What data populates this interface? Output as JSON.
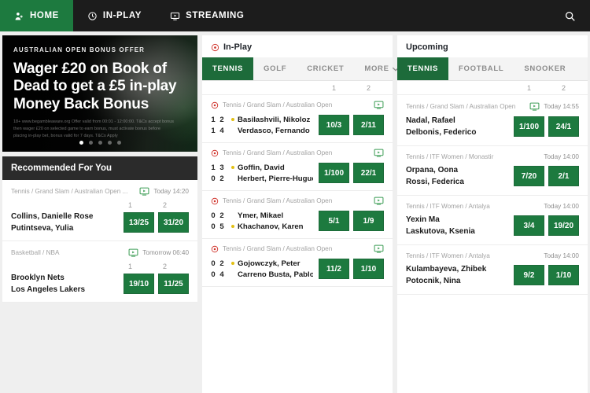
{
  "nav": {
    "items": [
      {
        "label": "HOME",
        "icon": "home-icon",
        "active": true
      },
      {
        "label": "IN-PLAY",
        "icon": "clock-icon",
        "active": false
      },
      {
        "label": "STREAMING",
        "icon": "monitor-icon",
        "active": false
      }
    ],
    "search_icon": "search-icon"
  },
  "banner": {
    "kicker": "AUSTRALIAN OPEN BONUS OFFER",
    "title": "Wager £20 on Book of Dead to get a £5 in-play Money Back Bonus",
    "terms": "18+ www.begambleaware.org Offer valid from 00:01 - 12:00:00. T&Cs accept bonus then wager £20 on selected game to earn bonus, must activate bonus before placing in-play bet, bonus valid for 7 days. T&Cs Apply",
    "dots": 5,
    "active_dot": 1
  },
  "recommended": {
    "title": "Recommended For You",
    "columns": [
      "1",
      "2"
    ],
    "events": [
      {
        "league": "Tennis / Grand Slam / Australian Open ...",
        "stream": true,
        "time": "Today 14:20",
        "participants": [
          "Collins, Danielle Rose",
          "Putintseva, Yulia"
        ],
        "odds": [
          "13/25",
          "31/20"
        ]
      },
      {
        "league": "Basketball / NBA",
        "stream": true,
        "time": "Tomorrow 06:40",
        "participants": [
          "Brooklyn Nets",
          "Los Angeles Lakers"
        ],
        "odds": [
          "19/10",
          "11/25"
        ]
      }
    ]
  },
  "inplay": {
    "title": "In-Play",
    "title_icon": "live-icon",
    "tabs": [
      {
        "label": "TENNIS",
        "active": true
      },
      {
        "label": "GOLF",
        "active": false
      },
      {
        "label": "CRICKET",
        "active": false
      }
    ],
    "more_label": "MORE",
    "more_icon": "chevron-down-icon",
    "columns": [
      "1",
      "2"
    ],
    "events": [
      {
        "league": "Tennis / Grand Slam / Australian Open",
        "live": true,
        "stream": true,
        "scores": [
          [
            "1",
            "2"
          ],
          [
            "1",
            "4"
          ]
        ],
        "participants": [
          "Basilashvili, Nikoloz",
          "Verdasco, Fernando"
        ],
        "serving": 0,
        "odds": [
          "10/3",
          "2/11"
        ]
      },
      {
        "league": "Tennis / Grand Slam / Australian Open",
        "live": true,
        "stream": true,
        "scores": [
          [
            "1",
            "3"
          ],
          [
            "0",
            "2"
          ]
        ],
        "participants": [
          "Goffin, David",
          "Herbert, Pierre-Hugues"
        ],
        "serving": 0,
        "odds": [
          "1/100",
          "22/1"
        ]
      },
      {
        "league": "Tennis / Grand Slam / Australian Open",
        "live": true,
        "stream": true,
        "scores": [
          [
            "0",
            "2"
          ],
          [
            "0",
            "5"
          ]
        ],
        "participants": [
          "Ymer, Mikael",
          "Khachanov, Karen"
        ],
        "serving": 1,
        "odds": [
          "5/1",
          "1/9"
        ]
      },
      {
        "league": "Tennis / Grand Slam / Australian Open",
        "live": true,
        "stream": true,
        "scores": [
          [
            "0",
            "2"
          ],
          [
            "0",
            "4"
          ]
        ],
        "participants": [
          "Gojowczyk, Peter",
          "Carreno Busta, Pablo"
        ],
        "serving": 0,
        "odds": [
          "11/2",
          "1/10"
        ]
      }
    ]
  },
  "upcoming": {
    "title": "Upcoming",
    "tabs": [
      {
        "label": "TENNIS",
        "active": true
      },
      {
        "label": "FOOTBALL",
        "active": false
      },
      {
        "label": "SNOOKER",
        "active": false
      }
    ],
    "columns": [
      "1",
      "2"
    ],
    "events": [
      {
        "league": "Tennis / Grand Slam / Australian Open",
        "stream": true,
        "time": "Today 14:55",
        "participants": [
          "Nadal, Rafael",
          "Delbonis, Federico"
        ],
        "odds": [
          "1/100",
          "24/1"
        ]
      },
      {
        "league": "Tennis / ITF Women / Monastir",
        "stream": false,
        "time": "Today 14:00",
        "participants": [
          "Orpana, Oona",
          "Rossi, Federica"
        ],
        "odds": [
          "7/20",
          "2/1"
        ]
      },
      {
        "league": "Tennis / ITF Women / Antalya",
        "stream": false,
        "time": "Today 14:00",
        "participants": [
          "Yexin Ma",
          "Laskutova, Ksenia"
        ],
        "odds": [
          "3/4",
          "19/20"
        ]
      },
      {
        "league": "Tennis / ITF Women / Antalya",
        "stream": false,
        "time": "Today 14:00",
        "participants": [
          "Kulambayeva, Zhibek",
          "Potocnik, Nina"
        ],
        "odds": [
          "9/2",
          "1/10"
        ]
      }
    ]
  },
  "colors": {
    "brand_green": "#1d7a3f",
    "tab_green": "#1d6b3a",
    "live_red": "#d0342c",
    "dark_nav": "#1c1c1c",
    "serve_yellow": "#e2c013"
  }
}
